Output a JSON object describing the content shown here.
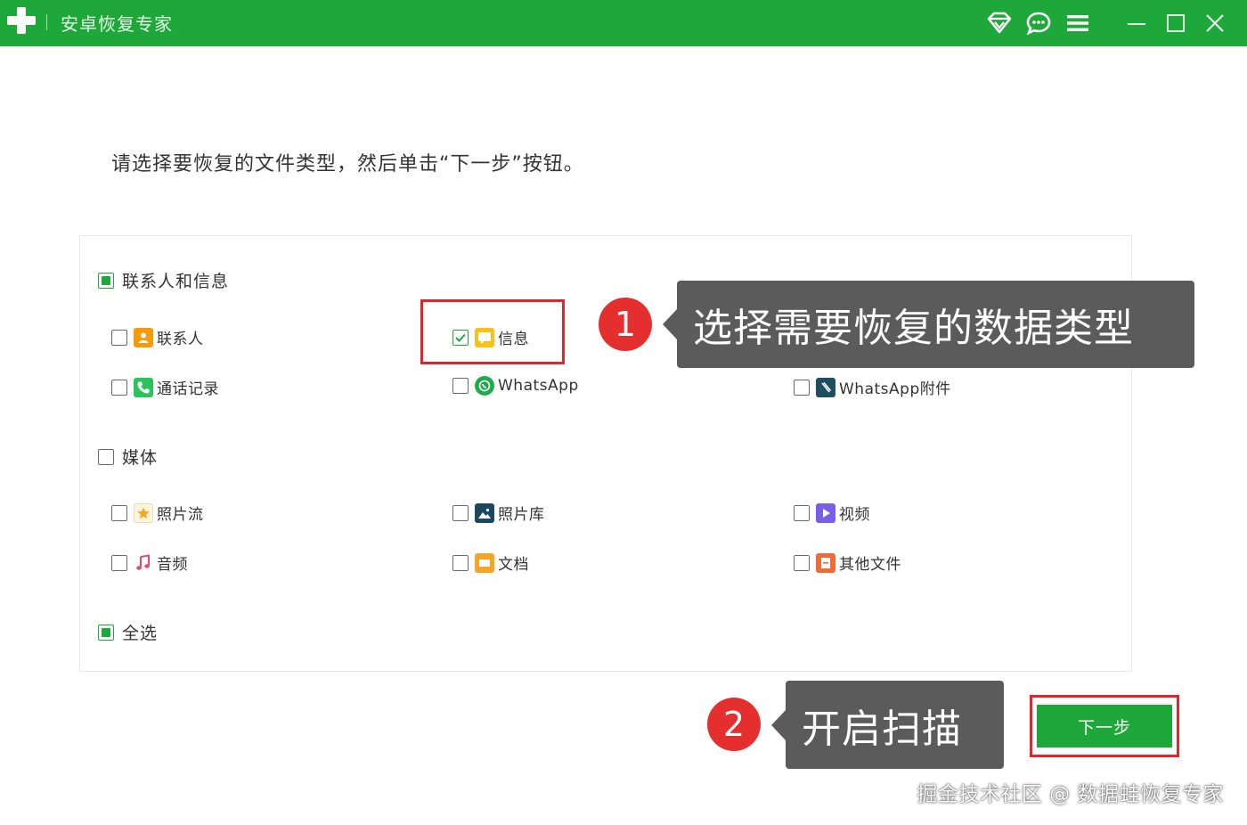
{
  "window": {
    "title": "安卓恢复专家"
  },
  "instruction": "请选择要恢复的文件类型，然后单击“下一步”按钮。",
  "groups": {
    "contacts": {
      "label": "联系人和信息",
      "state": "partial",
      "items": {
        "contacts": {
          "label": "联系人",
          "checked": false
        },
        "messages": {
          "label": "信息",
          "checked": true
        },
        "calllog": {
          "label": "通话记录",
          "checked": false
        },
        "whatsapp": {
          "label": "WhatsApp",
          "checked": false
        },
        "whatsapp_attach": {
          "label": "WhatsApp附件",
          "checked": false
        }
      }
    },
    "media": {
      "label": "媒体",
      "state": "unchecked",
      "items": {
        "photostream": {
          "label": "照片流",
          "checked": false
        },
        "gallery": {
          "label": "照片库",
          "checked": false
        },
        "video": {
          "label": "视频",
          "checked": false
        },
        "audio": {
          "label": "音频",
          "checked": false
        },
        "documents": {
          "label": "文档",
          "checked": false
        },
        "other": {
          "label": "其他文件",
          "checked": false
        }
      }
    },
    "select_all": {
      "label": "全选",
      "state": "partial"
    }
  },
  "annotations": {
    "step1": {
      "number": "1",
      "text": "选择需要恢复的数据类型"
    },
    "step2": {
      "number": "2",
      "text": "开启扫描"
    }
  },
  "next_button": "下一步",
  "watermark": "掘金技术社区 @ 数据蛙恢复专家",
  "colors": {
    "brand_green": "#1fa83a",
    "annotation_red": "#e52e2e",
    "callout_gray": "#5b5b5b"
  }
}
